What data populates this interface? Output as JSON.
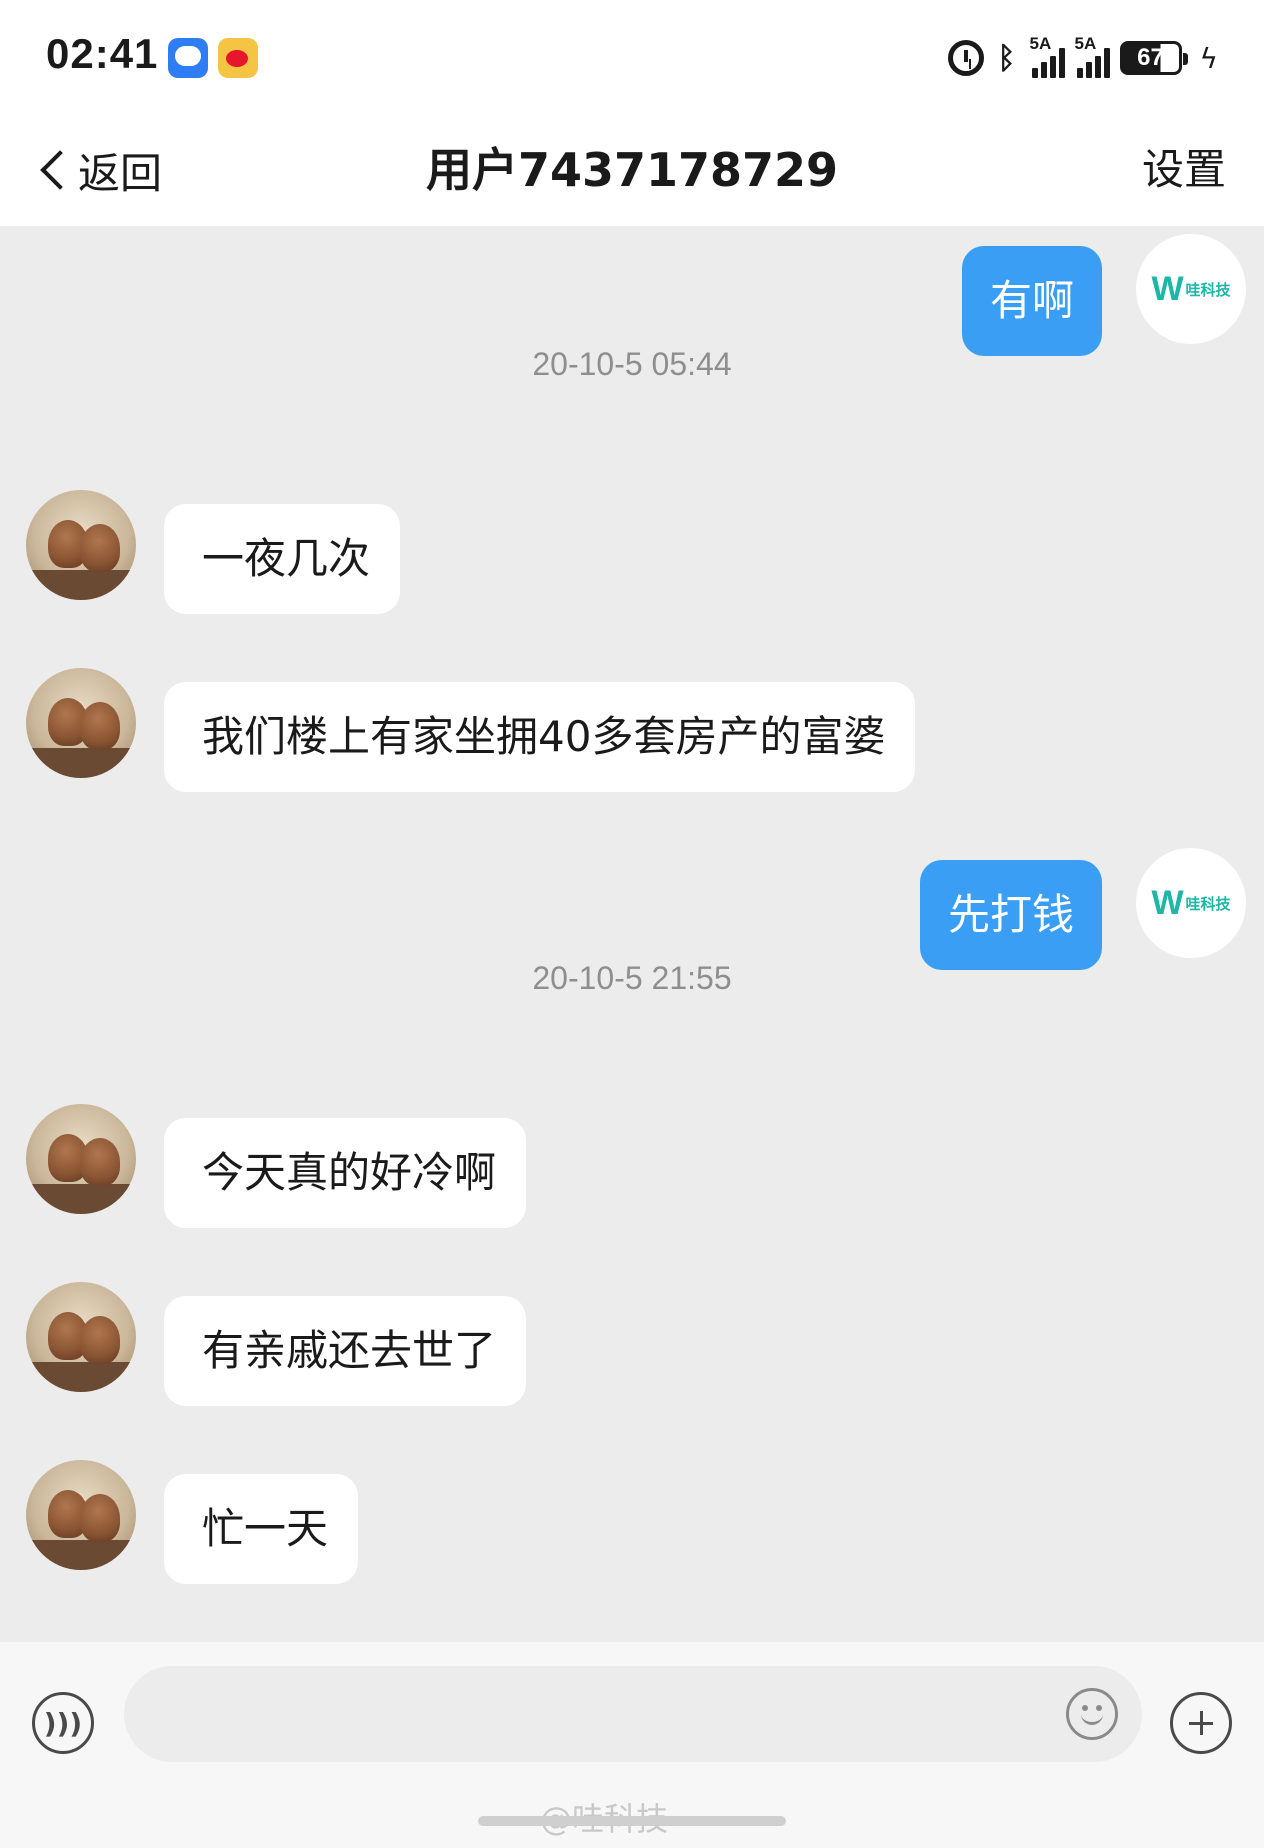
{
  "status_bar": {
    "time": "02:41",
    "apps": [
      "message-app-icon",
      "weibo-icon"
    ],
    "icons": [
      "alarm-icon",
      "bluetooth-icon",
      "signal-5a-icon",
      "signal-5a-icon",
      "battery-icon",
      "charging-icon"
    ],
    "signal1_label": "5A",
    "signal2_label": "5A",
    "battery_level": "67"
  },
  "nav": {
    "back_label": "返回",
    "title": "用户7437178729",
    "settings_label": "设置"
  },
  "self_avatar": {
    "logo_letter": "W",
    "logo_text": "哇科技"
  },
  "messages": [
    {
      "side": "self",
      "text": "有啊"
    },
    {
      "timestamp": "20-10-5 05:44"
    },
    {
      "side": "other",
      "text": "一夜几次"
    },
    {
      "side": "other",
      "text": "我们楼上有家坐拥40多套房产的富婆"
    },
    {
      "side": "self",
      "text": "先打钱"
    },
    {
      "timestamp": "20-10-5 21:55"
    },
    {
      "side": "other",
      "text": "今天真的好冷啊"
    },
    {
      "side": "other",
      "text": "有亲戚还去世了"
    },
    {
      "side": "other",
      "text": "忙一天"
    }
  ],
  "input": {
    "value": "",
    "placeholder": ""
  },
  "watermark": "@哇科技",
  "colors": {
    "self_bubble": "#3a9ef5",
    "other_bubble": "#ffffff",
    "chat_background": "#ececec",
    "logo_teal": "#1cb7a7"
  }
}
